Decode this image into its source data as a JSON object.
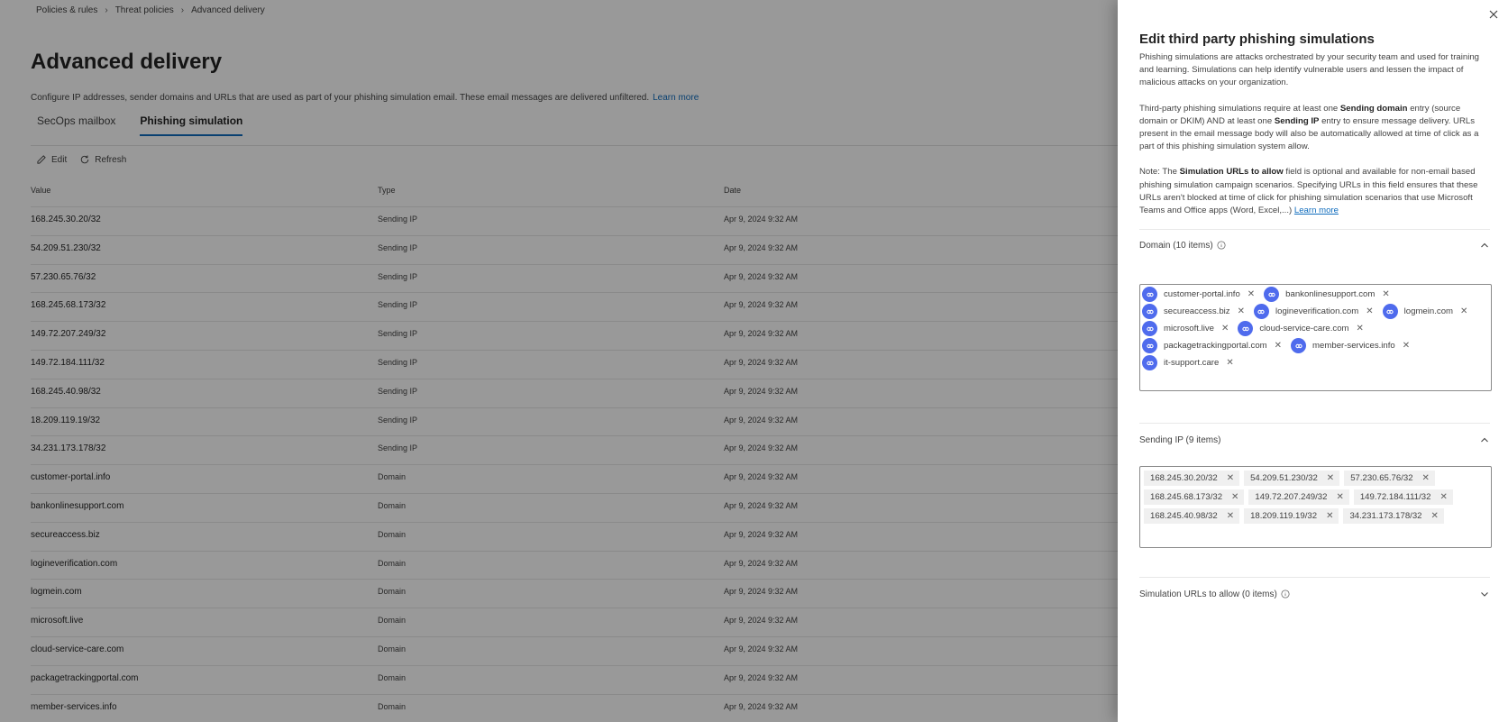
{
  "breadcrumb": [
    "Policies & rules",
    "Threat policies",
    "Advanced delivery"
  ],
  "page": {
    "title": "Advanced delivery",
    "description": "Configure IP addresses, sender domains and URLs that are used as part of your phishing simulation email. These email messages are delivered unfiltered.",
    "learn_more": "Learn more"
  },
  "tabs": [
    {
      "label": "SecOps mailbox",
      "active": false
    },
    {
      "label": "Phishing simulation",
      "active": true
    }
  ],
  "commands": {
    "edit": "Edit",
    "refresh": "Refresh"
  },
  "table": {
    "columns": [
      "Value",
      "Type",
      "Date"
    ],
    "rows": [
      {
        "value": "168.245.30.20/32",
        "type": "Sending IP",
        "date": "Apr 9, 2024 9:32 AM"
      },
      {
        "value": "54.209.51.230/32",
        "type": "Sending IP",
        "date": "Apr 9, 2024 9:32 AM"
      },
      {
        "value": "57.230.65.76/32",
        "type": "Sending IP",
        "date": "Apr 9, 2024 9:32 AM"
      },
      {
        "value": "168.245.68.173/32",
        "type": "Sending IP",
        "date": "Apr 9, 2024 9:32 AM"
      },
      {
        "value": "149.72.207.249/32",
        "type": "Sending IP",
        "date": "Apr 9, 2024 9:32 AM"
      },
      {
        "value": "149.72.184.111/32",
        "type": "Sending IP",
        "date": "Apr 9, 2024 9:32 AM"
      },
      {
        "value": "168.245.40.98/32",
        "type": "Sending IP",
        "date": "Apr 9, 2024 9:32 AM"
      },
      {
        "value": "18.209.119.19/32",
        "type": "Sending IP",
        "date": "Apr 9, 2024 9:32 AM"
      },
      {
        "value": "34.231.173.178/32",
        "type": "Sending IP",
        "date": "Apr 9, 2024 9:32 AM"
      },
      {
        "value": "customer-portal.info",
        "type": "Domain",
        "date": "Apr 9, 2024 9:32 AM"
      },
      {
        "value": "bankonlinesupport.com",
        "type": "Domain",
        "date": "Apr 9, 2024 9:32 AM"
      },
      {
        "value": "secureaccess.biz",
        "type": "Domain",
        "date": "Apr 9, 2024 9:32 AM"
      },
      {
        "value": "logineverification.com",
        "type": "Domain",
        "date": "Apr 9, 2024 9:32 AM"
      },
      {
        "value": "logmein.com",
        "type": "Domain",
        "date": "Apr 9, 2024 9:32 AM"
      },
      {
        "value": "microsoft.live",
        "type": "Domain",
        "date": "Apr 9, 2024 9:32 AM"
      },
      {
        "value": "cloud-service-care.com",
        "type": "Domain",
        "date": "Apr 9, 2024 9:32 AM"
      },
      {
        "value": "packagetrackingportal.com",
        "type": "Domain",
        "date": "Apr 9, 2024 9:32 AM"
      },
      {
        "value": "member-services.info",
        "type": "Domain",
        "date": "Apr 9, 2024 9:32 AM"
      }
    ]
  },
  "panel": {
    "title": "Edit third party phishing simulations",
    "para1": "Phishing simulations are attacks orchestrated by your security team and used for training and learning. Simulations can help identify vulnerable users and lessen the impact of malicious attacks on your organization.",
    "para2_a": "Third-party phishing simulations require at least one ",
    "para2_b": "Sending domain",
    "para2_c": " entry (source domain or DKIM) AND at least one ",
    "para2_d": "Sending IP",
    "para2_e": " entry to ensure message delivery. URLs present in the email message body will also be automatically allowed at time of click as a part of this phishing simulation system allow.",
    "para3_a": "Note: The ",
    "para3_b": "Simulation URLs to allow",
    "para3_c": " field is optional and available for non-email based phishing simulation campaign scenarios. Specifying URLs in this field ensures that these URLs aren't blocked at time of click for phishing simulation scenarios that use Microsoft Teams and Office apps (Word, Excel,...) ",
    "learn_more": "Learn more",
    "domain_section": {
      "label": "Domain (10 items)",
      "items": [
        "customer-portal.info",
        "bankonlinesupport.com",
        "secureaccess.biz",
        "logineverification.com",
        "logmein.com",
        "microsoft.live",
        "cloud-service-care.com",
        "packagetrackingportal.com",
        "member-services.info",
        "it-support.care"
      ]
    },
    "ip_section": {
      "label": "Sending IP (9 items)",
      "items": [
        "168.245.30.20/32",
        "54.209.51.230/32",
        "57.230.65.76/32",
        "168.245.68.173/32",
        "149.72.207.249/32",
        "149.72.184.111/32",
        "168.245.40.98/32",
        "18.209.119.19/32",
        "34.231.173.178/32"
      ]
    },
    "urls_section": {
      "label": "Simulation URLs to allow (0 items)"
    }
  },
  "colors": {
    "accent": "#0f6cbd",
    "domain_icon": "#4f6bed",
    "overlay": "rgba(0,0,0,0.4)"
  },
  "icons": {
    "edit": "pencil-icon",
    "refresh": "refresh-icon",
    "close": "close-icon",
    "info": "info-icon",
    "chevron_up": "chevron-up-icon",
    "chevron_down": "chevron-down-icon",
    "domain": "link-icon"
  }
}
